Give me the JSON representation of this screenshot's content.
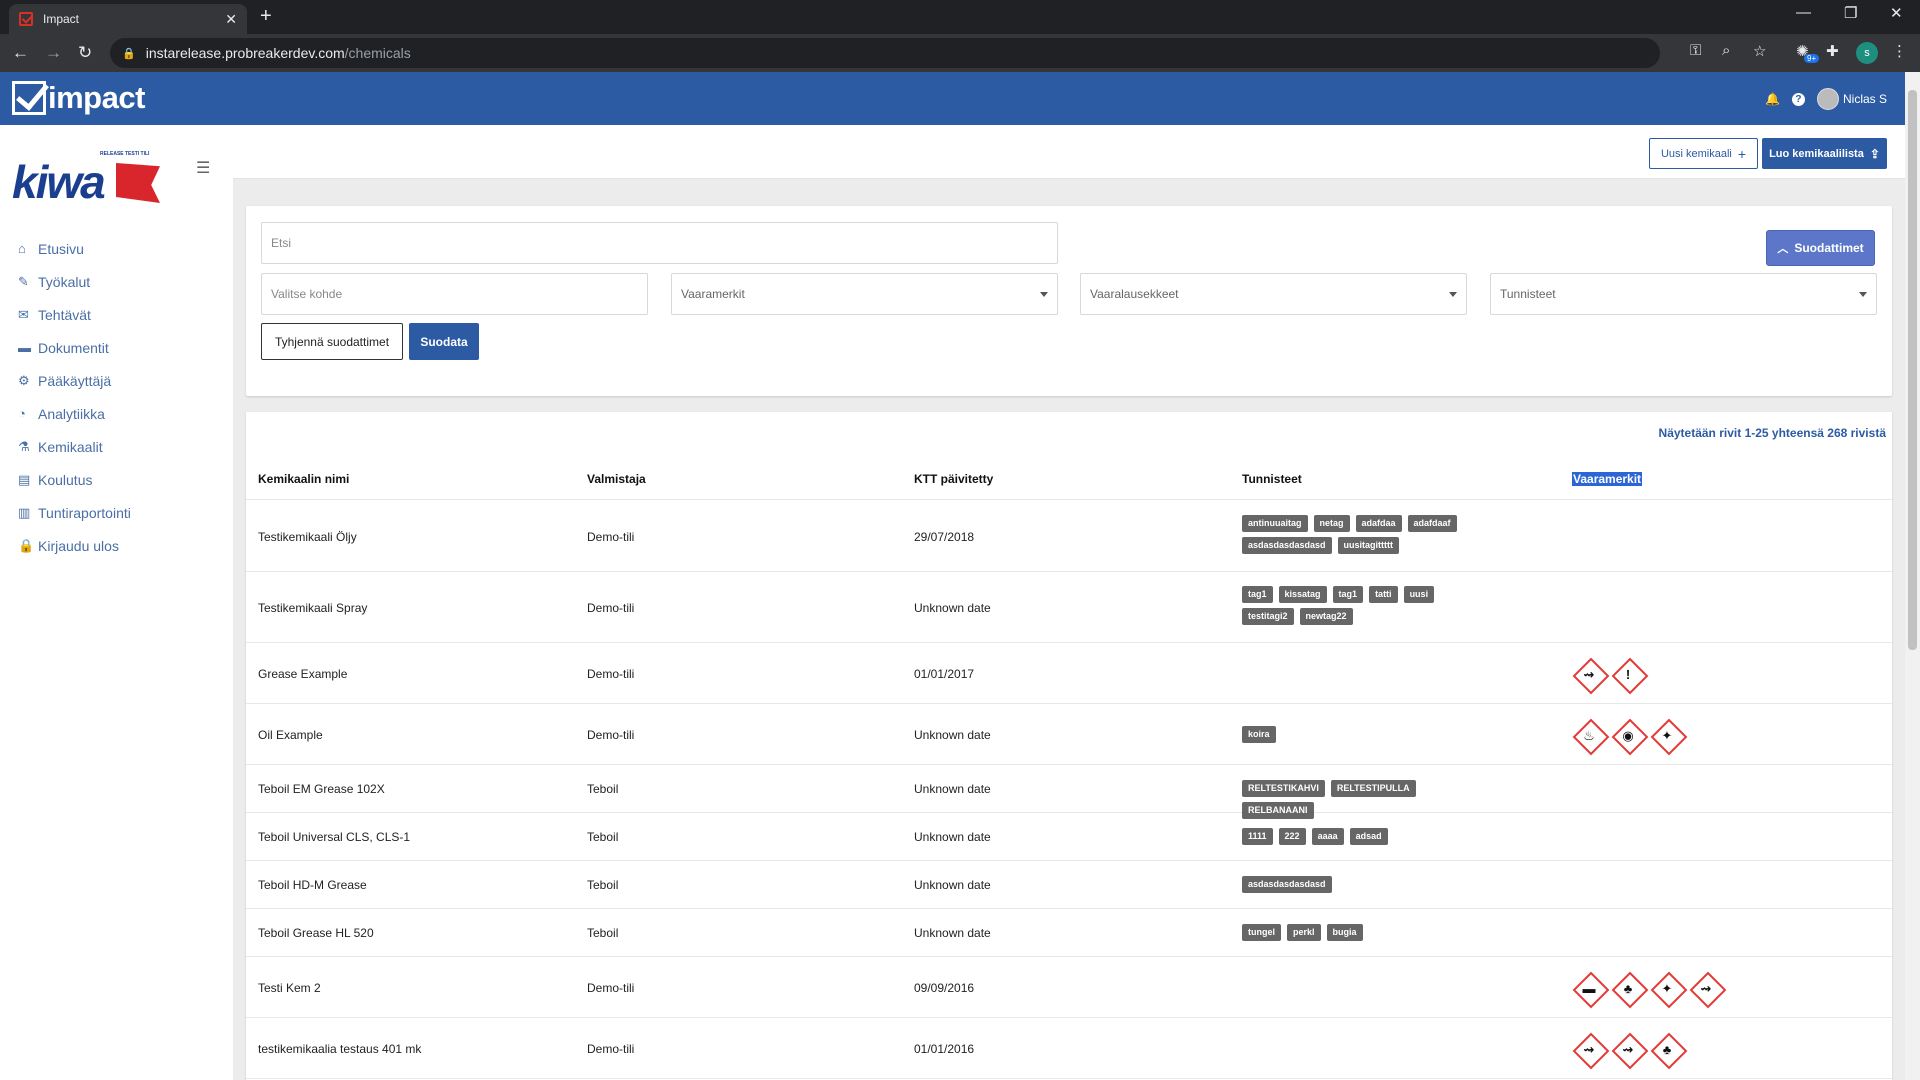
{
  "browser": {
    "tab_title": "Impact",
    "tab_close": "✕",
    "new_tab": "+",
    "url_host": "instarelease.probreakerdev.com",
    "url_path": "/chemicals",
    "profile_initial": "s",
    "ext_badge": "9+"
  },
  "app": {
    "logo_text": "impact",
    "user_name": "Niclas S"
  },
  "sidebar": {
    "brand_tagline": "RELEASE TESTI TILI",
    "brand_name": "kiwa",
    "items": [
      {
        "label": "Etusivu",
        "icon": "home-icon",
        "glyph": "⌂"
      },
      {
        "label": "Työkalut",
        "icon": "wrench-icon",
        "glyph": "✎"
      },
      {
        "label": "Tehtävät",
        "icon": "comments-icon",
        "glyph": "✉"
      },
      {
        "label": "Dokumentit",
        "icon": "folder-icon",
        "glyph": "▬"
      },
      {
        "label": "Pääkäyttäjä",
        "icon": "gears-icon",
        "glyph": "⚙"
      },
      {
        "label": "Analytiikka",
        "icon": "pie-chart-icon",
        "glyph": "◔"
      },
      {
        "label": "Kemikaalit",
        "icon": "flask-icon",
        "glyph": "⚗"
      },
      {
        "label": "Koulutus",
        "icon": "id-card-icon",
        "glyph": "▤"
      },
      {
        "label": "Tuntiraportointi",
        "icon": "bar-chart-icon",
        "glyph": "▥"
      },
      {
        "label": "Kirjaudu ulos",
        "icon": "lock-icon",
        "glyph": "🔒"
      }
    ]
  },
  "header": {
    "new_chemical": "Uusi kemikaali",
    "create_list": "Luo kemikaalilista"
  },
  "filters": {
    "search_placeholder": "Etsi",
    "toggle_label": "Suodattimet",
    "target_placeholder": "Valitse kohde",
    "hazard_symbols": "Vaaramerkit",
    "hazard_statements": "Vaaralausekkeet",
    "tags": "Tunnisteet",
    "clear_label": "Tyhjennä suodattimet",
    "apply_label": "Suodata"
  },
  "table": {
    "showing": "Näytetään rivit 1-25 yhteensä 268 rivistä",
    "columns": [
      "Kemikaalin nimi",
      "Valmistaja",
      "KTT päivitetty",
      "Tunnisteet",
      "Vaaramerkit"
    ],
    "rows": [
      {
        "name": "Testikemikaali Öljy",
        "maker": "Demo-tili",
        "date": "29/07/2018",
        "tags": [
          "antinuuaitag",
          "netag",
          "adafdaa",
          "adafdaaf",
          "asdasdasdasdasd",
          "uusitagittttt"
        ],
        "pictograms": []
      },
      {
        "name": "Testikemikaali Spray",
        "maker": "Demo-tili",
        "date": "Unknown date",
        "tags": [
          "tag1",
          "kissatag",
          "tag1",
          "tatti",
          "uusi",
          "testitagi2",
          "newtag22"
        ],
        "pictograms": []
      },
      {
        "name": "Grease Example",
        "maker": "Demo-tili",
        "date": "01/01/2017",
        "tags": [],
        "pictograms": [
          {
            "icon": "corrosion-icon",
            "glyph": "⇝"
          },
          {
            "icon": "exclamation-icon",
            "glyph": "!"
          }
        ]
      },
      {
        "name": "Oil Example",
        "maker": "Demo-tili",
        "date": "Unknown date",
        "tags": [
          "koira"
        ],
        "pictograms": [
          {
            "icon": "flame-icon",
            "glyph": "♨"
          },
          {
            "icon": "flame-over-circle-icon",
            "glyph": "◉"
          },
          {
            "icon": "health-hazard-icon",
            "glyph": "✦"
          }
        ]
      },
      {
        "name": "Teboil EM Grease 102X",
        "maker": "Teboil",
        "date": "Unknown date",
        "tags": [
          "RELTESTIKAHVI",
          "RELTESTIPULLA",
          "RELBANAANI"
        ],
        "pictograms": []
      },
      {
        "name": "Teboil Universal CLS, CLS-1",
        "maker": "Teboil",
        "date": "Unknown date",
        "tags": [
          "1111",
          "222",
          "aaaa",
          "adsad"
        ],
        "pictograms": []
      },
      {
        "name": "Teboil HD-M Grease",
        "maker": "Teboil",
        "date": "Unknown date",
        "tags": [
          "asdasdasdasdasd"
        ],
        "pictograms": []
      },
      {
        "name": "Teboil Grease HL 520",
        "maker": "Teboil",
        "date": "Unknown date",
        "tags": [
          "tungel",
          "perkl",
          "bugia"
        ],
        "pictograms": []
      },
      {
        "name": "Testi Kem 2",
        "maker": "Demo-tili",
        "date": "09/09/2016",
        "tags": [],
        "pictograms": [
          {
            "icon": "gas-cylinder-icon",
            "glyph": "▬"
          },
          {
            "icon": "environment-icon",
            "glyph": "♣"
          },
          {
            "icon": "health-hazard-icon",
            "glyph": "✦"
          },
          {
            "icon": "corrosion-icon",
            "glyph": "⇝"
          }
        ]
      },
      {
        "name": "testikemikaalia testaus 401 mk",
        "maker": "Demo-tili",
        "date": "01/01/2016",
        "tags": [],
        "pictograms": [
          {
            "icon": "corrosion-icon",
            "glyph": "⇝"
          },
          {
            "icon": "corrosion-icon",
            "glyph": "⇝"
          },
          {
            "icon": "environment-icon",
            "glyph": "♣"
          }
        ]
      }
    ]
  }
}
